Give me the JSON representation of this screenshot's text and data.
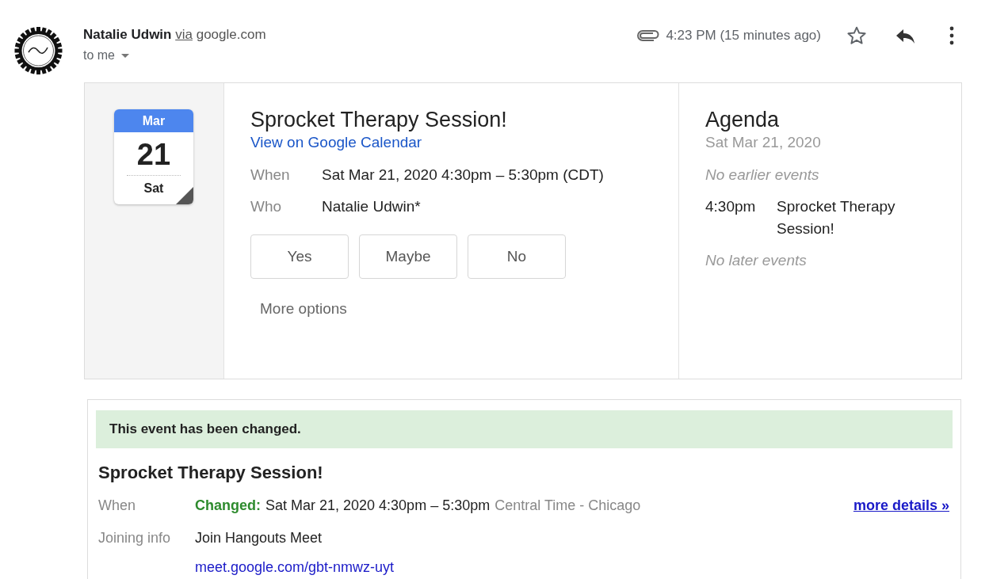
{
  "sender": {
    "name": "Natalie Udwin",
    "via": "via",
    "domain": "google.com",
    "to": "to me"
  },
  "header": {
    "time": "4:23 PM (15 minutes ago)",
    "has_attachment": true
  },
  "invite": {
    "calendar": {
      "month": "Mar",
      "day": "21",
      "weekday": "Sat"
    },
    "title": "Sprocket Therapy Session!",
    "calendar_link": "View on Google Calendar",
    "details": [
      {
        "label": "When",
        "value": "Sat Mar 21, 2020 4:30pm – 5:30pm (CDT)"
      },
      {
        "label": "Who",
        "value": "Natalie Udwin*"
      }
    ],
    "rsvp": [
      "Yes",
      "Maybe",
      "No"
    ],
    "more_options": "More options"
  },
  "agenda": {
    "title": "Agenda",
    "date": "Sat Mar 21, 2020",
    "items": [
      {
        "kind": "note",
        "text": "No earlier events"
      },
      {
        "kind": "event",
        "time": "4:30pm",
        "text": "Sprocket Therapy Session!"
      },
      {
        "kind": "note",
        "text": "No later events"
      }
    ]
  },
  "notice": {
    "banner": "This event has been changed.",
    "title": "Sprocket Therapy Session!",
    "when_label": "When",
    "changed_label": "Changed:",
    "when_value": "Sat Mar 21, 2020 4:30pm – 5:30pm",
    "timezone": "Central Time - Chicago",
    "more_details": "more details »",
    "joining_label": "Joining info",
    "joining_value": "Join Hangouts Meet",
    "meet_link": "meet.google.com/gbt-nmwz-uyt"
  }
}
